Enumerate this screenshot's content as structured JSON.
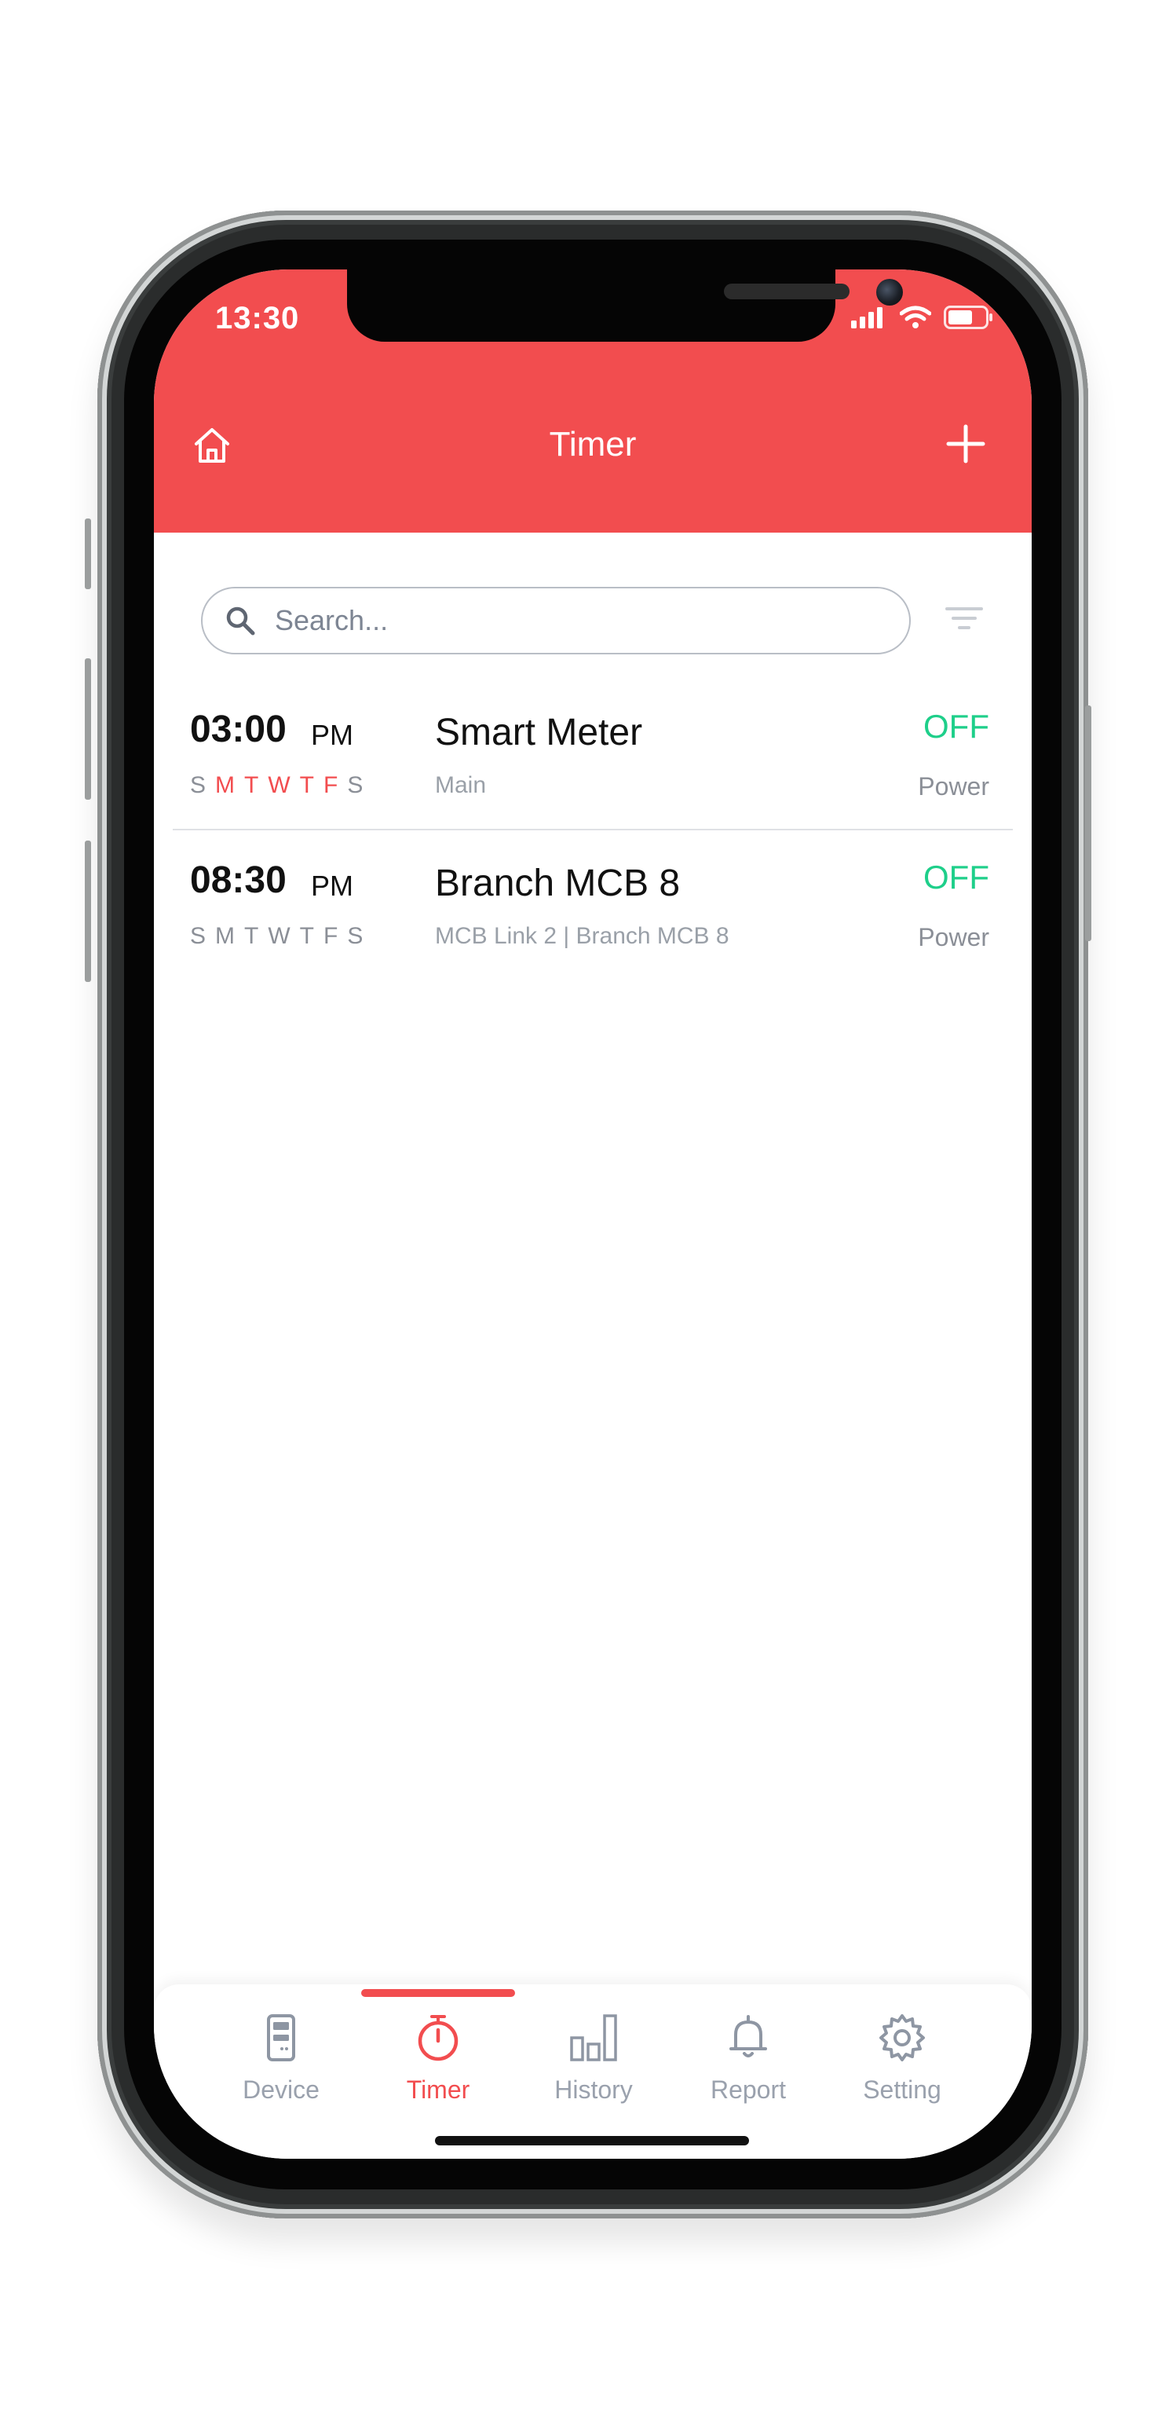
{
  "status_bar": {
    "time": "13:30"
  },
  "header": {
    "title": "Timer"
  },
  "search": {
    "placeholder": "Search..."
  },
  "timers": [
    {
      "time": "03:00",
      "ampm": "PM",
      "days": [
        {
          "letter": "S",
          "active": false
        },
        {
          "letter": "M",
          "active": true
        },
        {
          "letter": "T",
          "active": true
        },
        {
          "letter": "W",
          "active": true
        },
        {
          "letter": "T",
          "active": true
        },
        {
          "letter": "F",
          "active": true
        },
        {
          "letter": "S",
          "active": false
        }
      ],
      "device": "Smart Meter",
      "subtitle": "Main",
      "state": "OFF",
      "state_label": "Power"
    },
    {
      "time": "08:30",
      "ampm": "PM",
      "days": [
        {
          "letter": "S",
          "active": false
        },
        {
          "letter": "M",
          "active": false
        },
        {
          "letter": "T",
          "active": false
        },
        {
          "letter": "W",
          "active": false
        },
        {
          "letter": "T",
          "active": false
        },
        {
          "letter": "F",
          "active": false
        },
        {
          "letter": "S",
          "active": false
        }
      ],
      "device": "Branch MCB 8",
      "subtitle": "MCB Link 2 | Branch MCB 8",
      "state": "OFF",
      "state_label": "Power"
    }
  ],
  "tabbar": {
    "tabs": [
      {
        "label": "Device",
        "icon": "device-icon",
        "active": false
      },
      {
        "label": "Timer",
        "icon": "stopwatch-icon",
        "active": true
      },
      {
        "label": "History",
        "icon": "bar-chart-icon",
        "active": false
      },
      {
        "label": "Report",
        "icon": "bell-icon",
        "active": false
      },
      {
        "label": "Setting",
        "icon": "gear-icon",
        "active": false
      }
    ]
  },
  "colors": {
    "accent": "#f24d4f",
    "on_state": "#1ecf8a",
    "muted_text": "#9aa1ad"
  }
}
